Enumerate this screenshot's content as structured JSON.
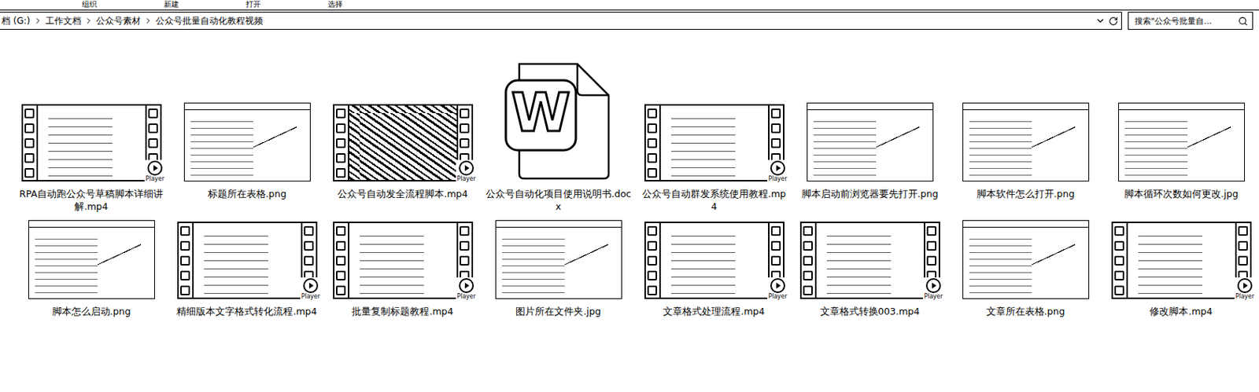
{
  "ribbon": {
    "groups": [
      "组织",
      "新建",
      "打开",
      "选择"
    ]
  },
  "address_bar": {
    "path": [
      "档 (G:)",
      "工作文档",
      "公众号素材",
      "公众号批量自动化教程视频"
    ]
  },
  "search": {
    "placeholder": "搜索\"公众号批量自..."
  },
  "files": [
    {
      "name": "RPA自动跑公众号草稿脚本详细讲解.mp4",
      "kind": "video",
      "picture": "screen",
      "badge": "Player"
    },
    {
      "name": "标题所在表格.png",
      "kind": "image",
      "picture": "screen"
    },
    {
      "name": "公众号自动发全流程脚本.mp4",
      "kind": "video",
      "picture": "photo",
      "badge": "Player"
    },
    {
      "name": "公众号自动化项目使用说明书.docx",
      "kind": "doc",
      "icon_letter": "W"
    },
    {
      "name": "公众号自动群发系统使用教程.mp4",
      "kind": "video",
      "picture": "screen",
      "badge": "Player"
    },
    {
      "name": "脚本启动前浏览器要先打开.png",
      "kind": "image",
      "picture": "screen"
    },
    {
      "name": "脚本软件怎么打开.png",
      "kind": "image",
      "picture": "screen"
    },
    {
      "name": "脚本循环次数如何更改.jpg",
      "kind": "image",
      "picture": "screen"
    },
    {
      "name": "脚本怎么启动.png",
      "kind": "image",
      "picture": "screen"
    },
    {
      "name": "精细版本文字格式转化流程.mp4",
      "kind": "video",
      "picture": "screen",
      "badge": "Player"
    },
    {
      "name": "批量复制标题教程.mp4",
      "kind": "video",
      "picture": "screen",
      "badge": "Player"
    },
    {
      "name": "图片所在文件夹.jpg",
      "kind": "image",
      "picture": "screen"
    },
    {
      "name": "文章格式处理流程.mp4",
      "kind": "video",
      "picture": "screen",
      "badge": "Player"
    },
    {
      "name": "文章格式转换003.mp4",
      "kind": "video",
      "picture": "screen",
      "badge": "Player"
    },
    {
      "name": "文章所在表格.png",
      "kind": "image",
      "picture": "screen"
    },
    {
      "name": "修改脚本.mp4",
      "kind": "video",
      "picture": "screen",
      "badge": "Player"
    }
  ]
}
